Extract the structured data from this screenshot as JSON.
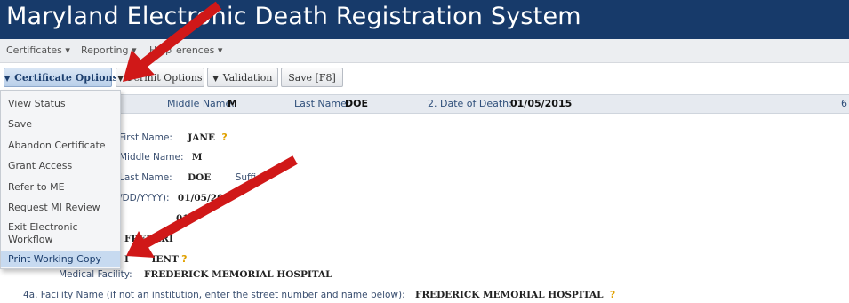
{
  "app": {
    "title": "Maryland Electronic Death Registration System"
  },
  "menubar": {
    "items": [
      "Certificates",
      "Reporting",
      "Help",
      "Preferences"
    ],
    "certificates": "Certificates ▾",
    "reporting": "Reporting ▾",
    "help": "Help",
    "preferences": "erences ▾"
  },
  "toolbar": {
    "certificate_options": "Certificate Options",
    "permit_options": "Permit Options",
    "validation": "Validation",
    "save": "Save [F8]"
  },
  "infobar": {
    "middle_label": "Middle Name:",
    "middle_value": "M",
    "last_label": "Last Name:",
    "last_value": "DOE",
    "dod_label": "2. Date of Death:",
    "dod_value": "01/05/2015",
    "edge": "6"
  },
  "dropdown": {
    "items": [
      "View Status",
      "Save",
      "Abandon Certificate",
      "Grant Access",
      "Refer to ME",
      "Request MI Review",
      "Exit Electronic Workflow",
      "Print Working Copy"
    ],
    "selected": "Print Working Copy"
  },
  "form": {
    "first_label": "First Name:",
    "first_value": "JANE",
    "middle_label": "Middle Name:",
    "middle_value": "M",
    "last_label": "Last Name:",
    "last_value": "DOE",
    "suffix_label": "Suffi",
    "date_label": "/DD/YYYY):",
    "date_value": "01/05/201",
    "date_value2": "010",
    "frederick_partial": "FREDERI",
    "inpatient_partial": "I       IENT",
    "medical_facility_label": "Medical Facility:",
    "medical_facility_value": "FREDERICK MEMORIAL HOSPITAL",
    "facility_label": "4a.   Facility Name (if not an institution, enter the street number and name below):",
    "facility_value": "FREDERICK MEMORIAL HOSPITAL"
  },
  "colors": {
    "title_bar": "#173a6a",
    "arrow": "#d01818",
    "help_icon": "#e0a100"
  }
}
